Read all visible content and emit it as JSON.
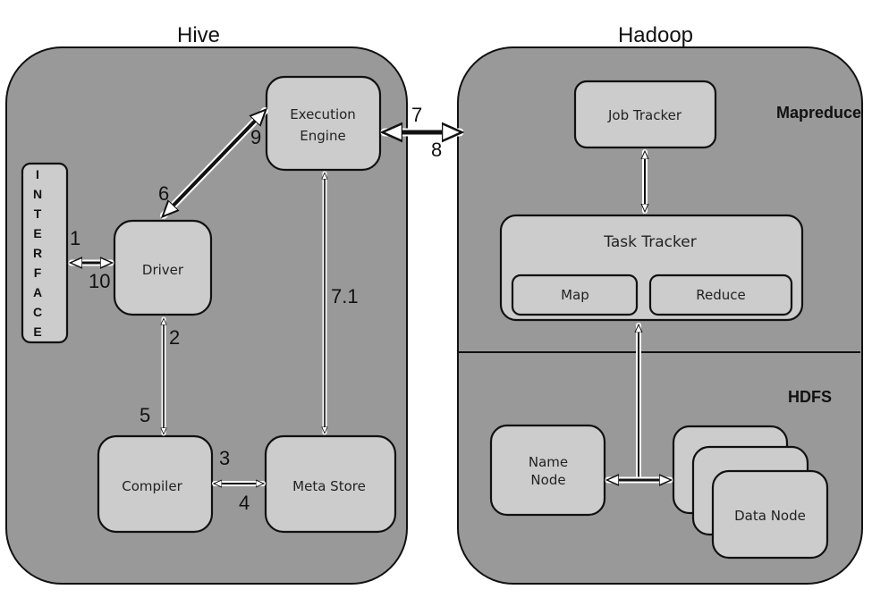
{
  "hive": {
    "title": "Hive",
    "interface_letters": [
      "I",
      "N",
      "T",
      "E",
      "R",
      "F",
      "A",
      "C",
      "E"
    ],
    "execution_engine": [
      "Execution",
      "Engine"
    ],
    "driver": "Driver",
    "compiler": "Compiler",
    "meta_store": "Meta Store"
  },
  "hadoop": {
    "title": "Hadoop",
    "mapreduce_label": "Mapreduce",
    "hdfs_label": "HDFS",
    "job_tracker": "Job Tracker",
    "task_tracker": "Task Tracker",
    "map": "Map",
    "reduce": "Reduce",
    "name_node": [
      "Name",
      "Node"
    ],
    "data_node": "Data Node"
  },
  "step_labels": {
    "s1": "1",
    "s10": "10",
    "s2": "2",
    "s5": "5",
    "s3": "3",
    "s4": "4",
    "s6": "6",
    "s9": "9",
    "s7": "7",
    "s8": "8",
    "s7_1": "7.1"
  }
}
